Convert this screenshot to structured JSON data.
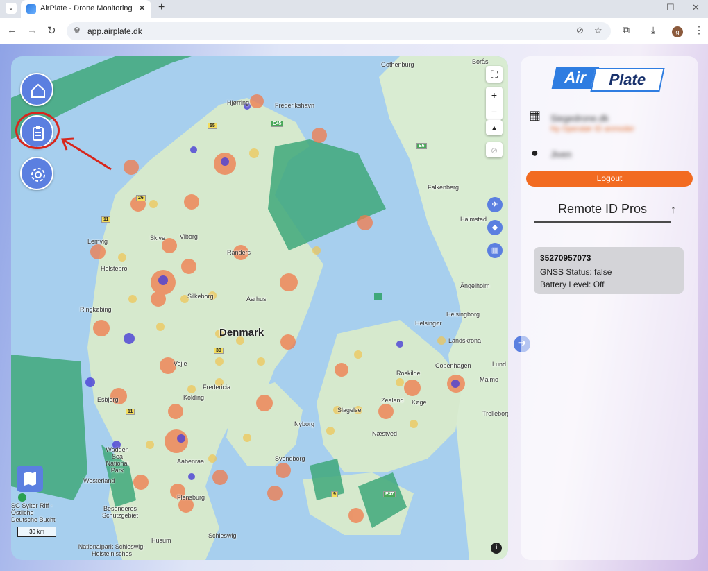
{
  "browser": {
    "tab_title": "AirPlate - Drone Monitoring & T",
    "url": "app.airplate.dk",
    "avatar_letter": "g",
    "accent": "#5b7fe0"
  },
  "map": {
    "country_label": "Denmark",
    "scale_label": "30 km",
    "cities": [
      "Gothenburg",
      "Borås",
      "Hjørring",
      "Frederikshavn",
      "Falkenberg",
      "Halmstad",
      "Skive",
      "Viborg",
      "Randers",
      "Holstebro",
      "Silkeborg",
      "Aarhus",
      "Ringkøbing",
      "Helsingborg",
      "Ängelholm",
      "Helsingør",
      "Landskrona",
      "Lund",
      "Copenhagen",
      "Malmo",
      "Vejle",
      "Fredericia",
      "Kolding",
      "Esbjerg",
      "Roskilde",
      "Køge",
      "Zealand",
      "Slagelse",
      "Nyborg",
      "Næstved",
      "Trelleborg",
      "Svendborg",
      "Aabenraa",
      "Flensburg",
      "Westerland",
      "Husum",
      "Schleswig",
      "Lemvig",
      "Besonderes Schutzgebiet",
      "Wadden Sea National Park",
      "Nationalpark Schleswig-Holsteinisches",
      "SG Sylter Riff - Östliche Deutsche Bucht"
    ],
    "road_numbers": [
      "55",
      "E45",
      "E6",
      "11",
      "26",
      "30",
      "11",
      "9",
      "E47"
    ]
  },
  "sidebar_nav": {
    "items": [
      "home-icon",
      "clipboard-icon",
      "settings-icon"
    ]
  },
  "panel": {
    "logo_part1": "Air",
    "logo_part2": "Plate",
    "org_name": "Siegedrone.dk",
    "org_sub": "Ny Operatør ID anmoder",
    "user_name": "Jiven",
    "logout_label": "Logout",
    "section_title": "Remote ID Pros",
    "card": {
      "id": "35270957073",
      "gnss": "GNSS Status: false",
      "battery": "Battery Level: Off"
    }
  }
}
